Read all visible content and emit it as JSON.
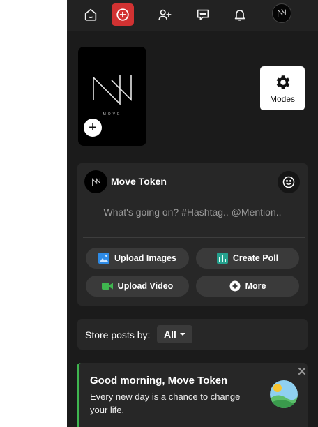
{
  "nav": {
    "items": [
      {
        "icon": "home-icon"
      },
      {
        "icon": "create-plus-icon",
        "active_color": "#d13232"
      },
      {
        "icon": "add-user-icon"
      },
      {
        "icon": "chat-icon"
      },
      {
        "icon": "bell-icon"
      },
      {
        "icon": "profile-avatar"
      }
    ]
  },
  "profile": {
    "logo_text": "MOVE",
    "add_label": "+",
    "modes_label": "Modes"
  },
  "composer": {
    "name": "Move Token",
    "placeholder": "What's going on? #Hashtag.. @Mention..",
    "upload_images": "Upload Images",
    "create_poll": "Create Poll",
    "upload_video": "Upload Video",
    "more": "More"
  },
  "store": {
    "label": "Store posts by:",
    "selected": "All"
  },
  "greeting": {
    "title": "Good morning, Move Token",
    "text": "Every new day is a chance to change your life."
  },
  "colors": {
    "accent_red": "#d13232",
    "accent_green": "#3fb54f",
    "image_icon": "#2e8be6",
    "poll_icon": "#25a18e",
    "video_icon": "#3fb54f"
  }
}
